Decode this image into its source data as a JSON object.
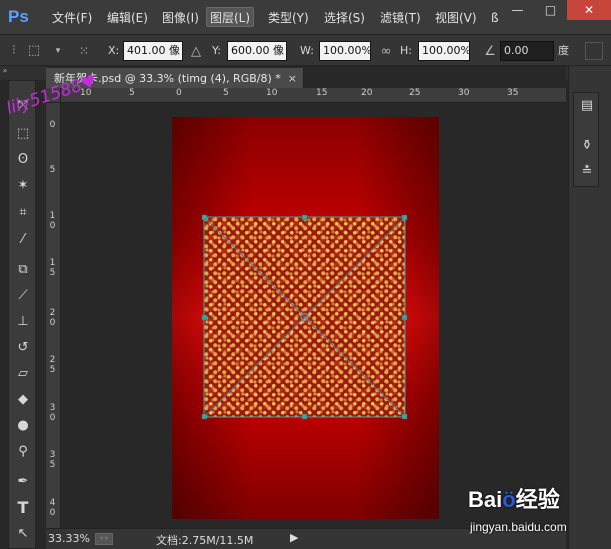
{
  "app": {
    "logo": "Ps",
    "logo_color": "#5fa0ff"
  },
  "menu": [
    {
      "label": "文件(F)"
    },
    {
      "label": "编辑(E)"
    },
    {
      "label": "图像(I)"
    },
    {
      "label": "图层(L)",
      "active": true
    },
    {
      "label": "类型(Y)"
    },
    {
      "label": "选择(S)"
    },
    {
      "label": "滤镜(T)"
    },
    {
      "label": "视图(V)"
    },
    {
      "label": "ß"
    }
  ],
  "window_controls": {
    "minimize": "—",
    "maximize": "□",
    "close": "✕"
  },
  "options": {
    "x_label": "X:",
    "x_value": "401.00 像",
    "y_label": "Y:",
    "y_value": "600.00 像",
    "w_label": "W:",
    "w_value": "100.00%",
    "h_label": "H:",
    "h_value": "100.00%",
    "angle_value": "0.00",
    "angle_unit": "度",
    "delta_icon": "△",
    "link_icon": "∞",
    "angle_icon": "∠"
  },
  "document": {
    "tab_title": "新年贺卡.psd @ 33.3% (timg (4), RGB/8) *",
    "tab_close": "×"
  },
  "rulers": {
    "top": [
      "10",
      "5",
      "0",
      "5",
      "10",
      "15",
      "20",
      "25",
      "30",
      "35"
    ],
    "left": [
      "0",
      "5",
      "1 0",
      "1 5",
      "2 0",
      "2 5",
      "3 0",
      "3 5",
      "4 0"
    ]
  },
  "overlay": {
    "user_watermark": "lily51588♥"
  },
  "status": {
    "zoom": "33.33%",
    "doc_size": "文档:2.75M/11.5M",
    "arrow": "▶"
  },
  "watermark": {
    "brand": "Bai",
    "brand_paw": "ö",
    "brand_suffix": "经验",
    "site": "jingyan.baidu.com"
  },
  "colors": {
    "card_red": "#ff0a0a",
    "card_dark": "#8a0000",
    "handle": "#3aa8a0"
  }
}
